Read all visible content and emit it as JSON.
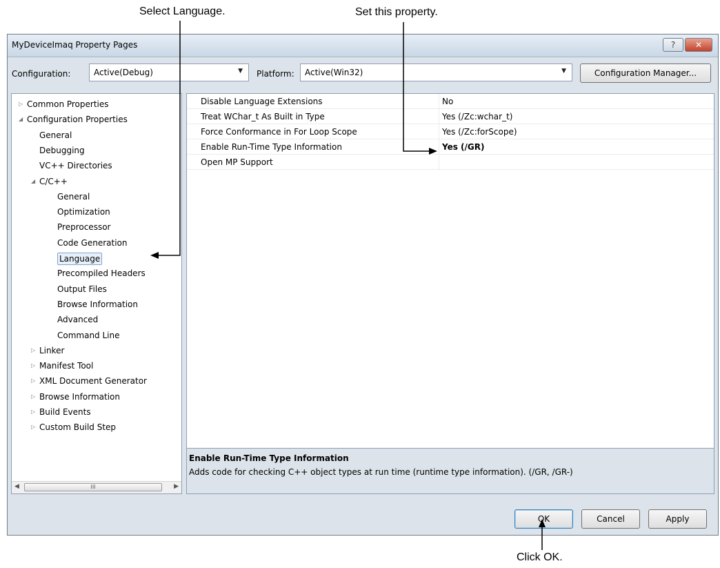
{
  "callouts": {
    "select_language": "Select Language.",
    "set_property": "Set this property.",
    "click_ok": "Click OK."
  },
  "window": {
    "title": "MyDeviceImaq Property Pages",
    "help_label": "?",
    "close_label": "✕"
  },
  "toolbar": {
    "configuration_label": "Configuration:",
    "configuration_value": "Active(Debug)",
    "platform_label": "Platform:",
    "platform_value": "Active(Win32)",
    "config_manager_label": "Configuration Manager..."
  },
  "tree": {
    "items": [
      {
        "label": "Common Properties",
        "arrow": "▷"
      },
      {
        "label": "Configuration Properties",
        "arrow": "◢"
      },
      {
        "label": "General",
        "arrow": ""
      },
      {
        "label": "Debugging",
        "arrow": ""
      },
      {
        "label": "VC++ Directories",
        "arrow": ""
      },
      {
        "label": "C/C++",
        "arrow": "◢"
      },
      {
        "label": "General",
        "arrow": ""
      },
      {
        "label": "Optimization",
        "arrow": ""
      },
      {
        "label": "Preprocessor",
        "arrow": ""
      },
      {
        "label": "Code Generation",
        "arrow": ""
      },
      {
        "label": "Language",
        "arrow": ""
      },
      {
        "label": "Precompiled Headers",
        "arrow": ""
      },
      {
        "label": "Output Files",
        "arrow": ""
      },
      {
        "label": "Browse Information",
        "arrow": ""
      },
      {
        "label": "Advanced",
        "arrow": ""
      },
      {
        "label": "Command Line",
        "arrow": ""
      },
      {
        "label": "Linker",
        "arrow": "▷"
      },
      {
        "label": "Manifest Tool",
        "arrow": "▷"
      },
      {
        "label": "XML Document Generator",
        "arrow": "▷"
      },
      {
        "label": "Browse Information",
        "arrow": "▷"
      },
      {
        "label": "Build Events",
        "arrow": "▷"
      },
      {
        "label": "Custom Build Step",
        "arrow": "▷"
      }
    ],
    "scroll_thumb": "III"
  },
  "properties": {
    "rows": [
      {
        "name": "Disable Language Extensions",
        "value": "No"
      },
      {
        "name": "Treat WChar_t As Built in Type",
        "value": "Yes (/Zc:wchar_t)"
      },
      {
        "name": "Force Conformance in For Loop Scope",
        "value": "Yes (/Zc:forScope)"
      },
      {
        "name": "Enable Run-Time Type Information",
        "value": "Yes (/GR)"
      },
      {
        "name": "Open MP Support",
        "value": ""
      }
    ]
  },
  "description": {
    "title": "Enable Run-Time Type Information",
    "text": "Adds code for checking C++ object types at run time (runtime type information).     (/GR, /GR-)"
  },
  "buttons": {
    "ok": "OK",
    "cancel": "Cancel",
    "apply": "Apply"
  }
}
